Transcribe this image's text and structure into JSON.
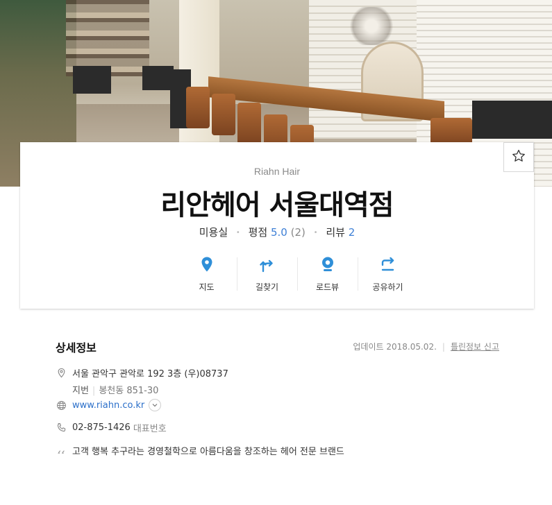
{
  "place": {
    "sub_name": "Riahn Hair",
    "name": "리안헤어 서울대역점",
    "category": "미용실",
    "rating_label": "평점",
    "rating_value": "5.0",
    "rating_count": "(2)",
    "review_label": "리뷰",
    "review_count": "2"
  },
  "favorite": {
    "icon": "star-outline-icon"
  },
  "actions": [
    {
      "label": "지도",
      "icon": "map-pin-icon"
    },
    {
      "label": "길찾기",
      "icon": "directions-icon"
    },
    {
      "label": "로드뷰",
      "icon": "roadview-icon"
    },
    {
      "label": "공유하기",
      "icon": "share-icon"
    }
  ],
  "details": {
    "title": "상세정보",
    "updated": "업데이트 2018.05.02.",
    "report_link": "틀린정보 신고",
    "address": "서울 관악구 관악로 192 3층 (우)08737",
    "jibeon_label": "지번",
    "jibeon_value": "봉천동 851-30",
    "website": "www.riahn.co.kr",
    "phone": "02-875-1426",
    "phone_label": "대표번호",
    "description": "고객 행복 추구라는 경영철학으로 아름다움을 창조하는 헤어 전문 브랜드"
  },
  "colors": {
    "accent_blue": "#2f8fd8",
    "link_blue": "#2b6fc9"
  }
}
